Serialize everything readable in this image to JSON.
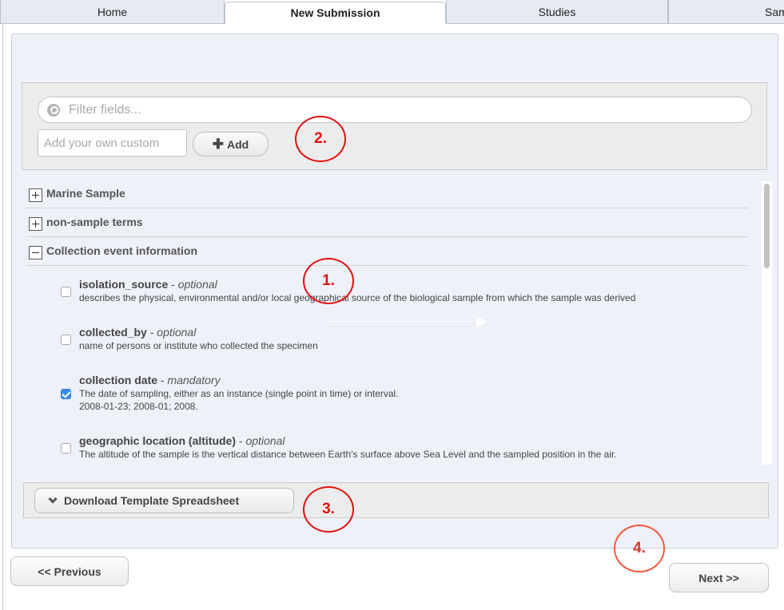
{
  "tabs": [
    {
      "label": "Home",
      "active": false
    },
    {
      "label": "New Submission",
      "active": true
    },
    {
      "label": "Studies",
      "active": false
    },
    {
      "label": "Samp",
      "active": false
    }
  ],
  "filter": {
    "search_placeholder": "Filter fields...",
    "custom_placeholder": "Add your own custom",
    "add_label": "Add"
  },
  "groups": [
    {
      "label": "Marine Sample",
      "expanded": false
    },
    {
      "label": "non-sample terms",
      "expanded": false
    },
    {
      "label": "Collection event information",
      "expanded": true
    }
  ],
  "fields": [
    {
      "name": "isolation_source",
      "sep": " - ",
      "requirement": "optional",
      "description": "describes the physical, environmental and/or local geographical source of the biological sample from which the sample was derived",
      "example": "",
      "checked": false
    },
    {
      "name": "collected_by",
      "sep": " - ",
      "requirement": "optional",
      "description": "name of persons or institute who collected the specimen",
      "example": "",
      "checked": false
    },
    {
      "name": "collection date",
      "sep": " - ",
      "requirement": "mandatory",
      "description": "The date of sampling, either as an instance (single point in time) or interval.",
      "example": "2008-01-23; 2008-01; 2008.",
      "checked": true
    },
    {
      "name": "geographic location (altitude)",
      "sep": " - ",
      "requirement": "optional",
      "description": "The altitude of the sample is the vertical distance between Earth's surface above Sea Level and the sampled position in the air.",
      "example": "",
      "checked": false
    }
  ],
  "download": {
    "label": "Download Template Spreadsheet"
  },
  "nav": {
    "previous_label": "<< Previous",
    "next_label": "Next >>"
  },
  "annotations": [
    "1.",
    "2.",
    "3.",
    "4."
  ],
  "colors": {
    "annotation": "#e31010",
    "checkbox_checked": "#3b8ee9",
    "panel": "#eef1f8"
  }
}
